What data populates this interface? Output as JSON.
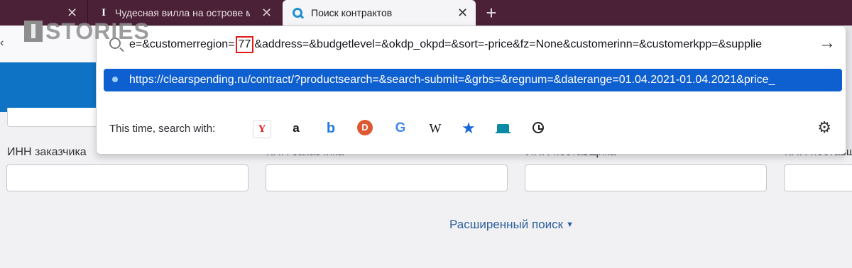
{
  "tabs": [
    {
      "title": "",
      "close": "✕"
    },
    {
      "title": "Чудесная вилла на острове м",
      "close": "✕"
    },
    {
      "title": "Поиск контрактов",
      "close": "✕"
    }
  ],
  "new_tab": "+",
  "watermark": {
    "text": "STORIES"
  },
  "urlbar": {
    "value_before": "e=&customerregion=",
    "value_highlight": "77",
    "value_after": "&address=&budgetlevel=&okdp_okpd=&sort=-price&fz=None&customerinn=&customerkpp=&supplie",
    "go": "→"
  },
  "suggestion": {
    "url": "https://clearspending.ru/contract/?productsearch=&search-submit=&grbs=&regnum=&daterange=01.04.2021-01.04.2021&price_"
  },
  "search_engines": {
    "label": "This time, search with:",
    "icons": [
      "yandex-icon",
      "amazon-icon",
      "bing-icon",
      "duckduckgo-icon",
      "google-icon",
      "wikipedia-icon",
      "bookmarks-star-icon",
      "tabs-icon",
      "history-icon"
    ],
    "settings": "⚙"
  },
  "form": {
    "fields": [
      {
        "label": "ИНН заказчика"
      },
      {
        "label": "КПП заказчика"
      },
      {
        "label": "ИНН поставщика"
      },
      {
        "label": "КПП поставщика"
      }
    ],
    "advanced_search": "Расширенный поиск"
  },
  "colors": {
    "tabbar": "#4a2136",
    "bluebar": "#0e73c4",
    "highlight_box": "#e21a1a",
    "suggestion_bg": "#0e5fcf"
  }
}
